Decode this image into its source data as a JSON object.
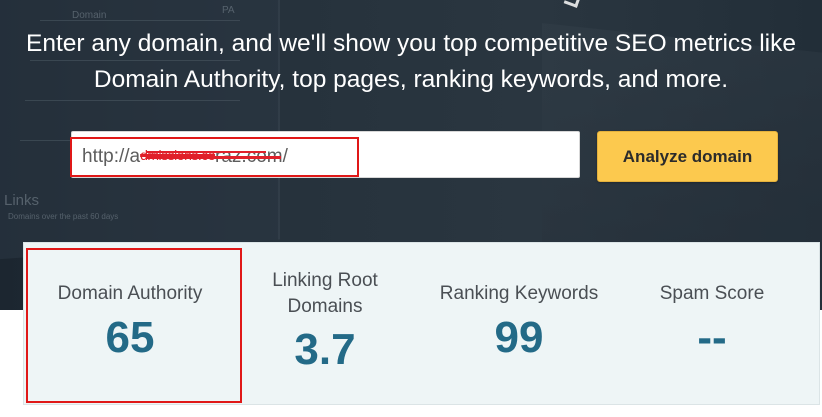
{
  "hero": {
    "subtitle_line1": "Enter any domain, and we'll show you top competitive SEO metrics like",
    "subtitle_line2": "Domain Authority, top pages, ranking keywords, and more.",
    "background_fragments": [
      "Domain",
      "Links",
      "PA",
      "PA",
      "Domains over the past 60 days"
    ]
  },
  "search": {
    "url_prefix": "http://a",
    "url_redacted": "dmissions.co",
    "url_suffix": "raz.com/",
    "analyze_label": "Analyze domain"
  },
  "metrics": [
    {
      "label": "Domain Authority",
      "value": "65"
    },
    {
      "label": "Linking Root Domains",
      "value": "3.7"
    },
    {
      "label": "Ranking Keywords",
      "value": "99"
    },
    {
      "label": "Spam Score",
      "value": "--"
    }
  ],
  "colors": {
    "button": "#fcc94e",
    "metric_value": "#236a87",
    "highlight": "#e01818",
    "panel": "#eef5f6"
  }
}
